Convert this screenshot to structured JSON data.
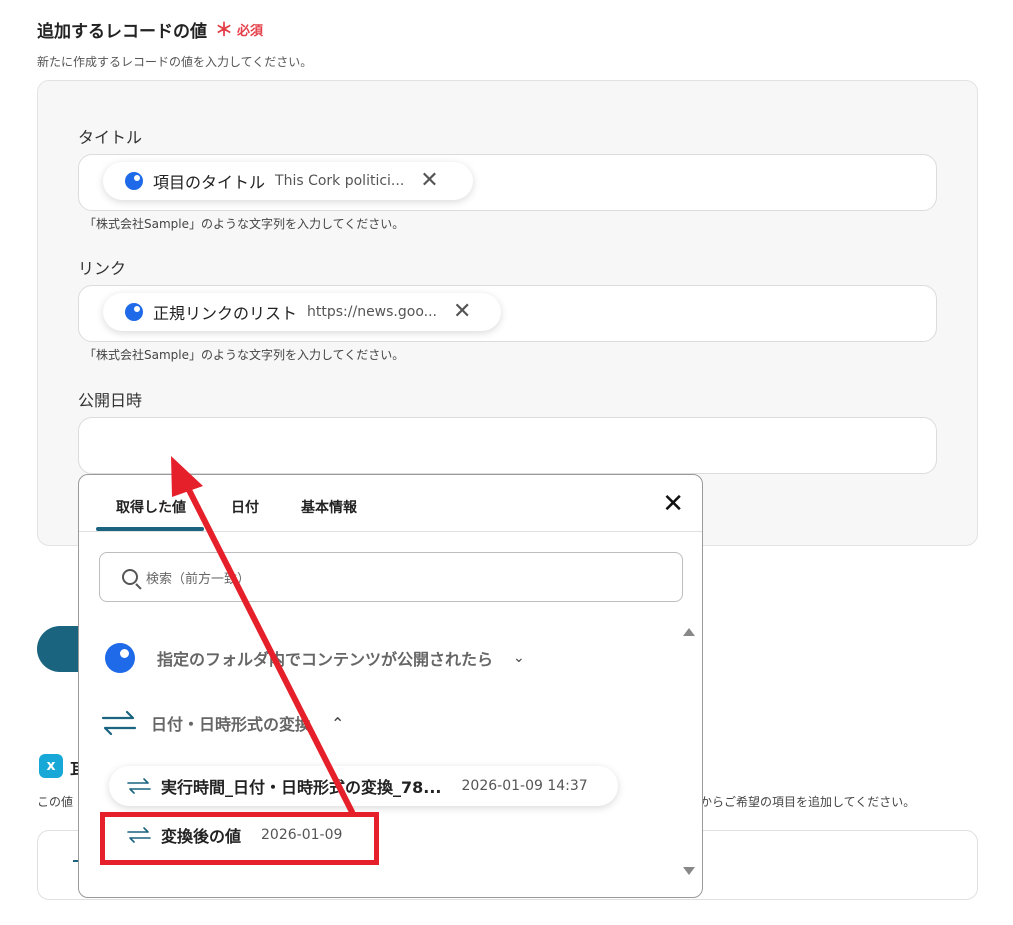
{
  "section": {
    "title": "追加するレコードの値",
    "required_mark": "＊",
    "required_text": "必須",
    "description": "新たに作成するレコードの値を入力してください。"
  },
  "fields": [
    {
      "label": "タイトル",
      "chip_name": "項目のタイトル",
      "chip_value": "This Cork politici...",
      "hint": "「株式会社Sample」のような文字列を入力してください。"
    },
    {
      "label": "リンク",
      "chip_name": "正規リンクのリスト",
      "chip_value": "https://news.goo...",
      "hint": "「株式会社Sample」のような文字列を入力してください。"
    },
    {
      "label": "公開日時"
    }
  ],
  "popup": {
    "tabs": [
      "取得した値",
      "日付",
      "基本情報"
    ],
    "active_tab": "取得した値",
    "search_placeholder": "検索（前方一致）",
    "groups": [
      {
        "label": "指定のフォルダ内でコンテンツが公開されたら",
        "icon": "blue-dot-icon",
        "expanded": false
      },
      {
        "label": "日付・日時形式の変換",
        "icon": "swap-arrows-icon",
        "expanded": true
      }
    ],
    "items": [
      {
        "name": "実行時間_日付・日時形式の変換_78...",
        "value": "2026-01-09 14:37"
      },
      {
        "name": "変換後の値",
        "value": "2026-01-09"
      }
    ]
  },
  "background": {
    "partial_title": "耳",
    "partial_desc_left": "この値",
    "partial_desc_right": "からご希望の項目を追加してください。"
  },
  "colors": {
    "accent": "#1a6480",
    "required": "#e5404a",
    "annotation": "#e5202a",
    "chip_dot": "#1e6ae8"
  }
}
